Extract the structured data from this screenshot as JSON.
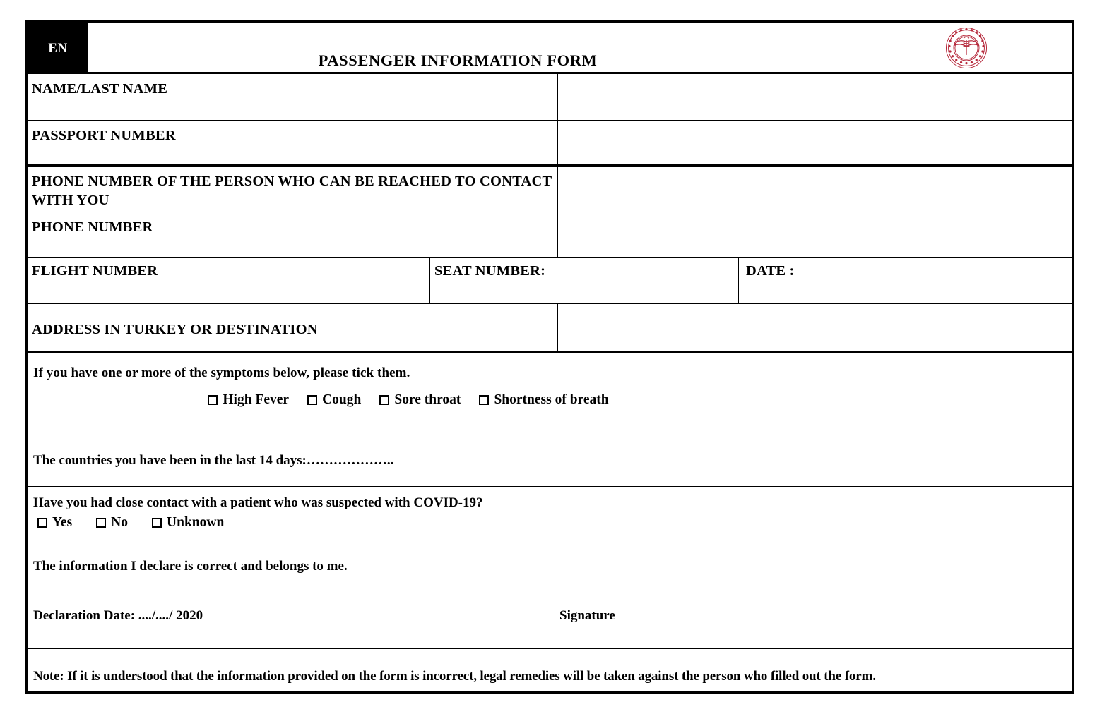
{
  "header": {
    "language_badge": "EN",
    "title": "PASSENGER INFORMATION FORM",
    "logo_name": "ministry-of-health-emblem",
    "logo_color": "#b5273a"
  },
  "fields": [
    {
      "label": "NAME/LAST NAME",
      "value": ""
    },
    {
      "label": "PASSPORT NUMBER",
      "value": ""
    },
    {
      "label": "PHONE NUMBER OF  THE PERSON WHO CAN BE REACHED TO CONTACT WITH YOU",
      "value": ""
    },
    {
      "label": "PHONE NUMBER",
      "value": ""
    }
  ],
  "flight_row": {
    "flight_label": "FLIGHT NUMBER",
    "flight_value": "",
    "seat_label": "SEAT NUMBER:",
    "seat_value": "",
    "date_label": "DATE :",
    "date_value": ""
  },
  "address": {
    "label": "ADDRESS IN TURKEY OR DESTINATION",
    "value": ""
  },
  "symptoms": {
    "prompt": "If you have one or more of the symptoms below, please tick them.",
    "options": [
      {
        "label": "High Fever",
        "checked": false
      },
      {
        "label": "Cough",
        "checked": false
      },
      {
        "label": "Sore throat",
        "checked": false
      },
      {
        "label": "Shortness of breath",
        "checked": false
      }
    ]
  },
  "countries": {
    "text": "The countries you have been in the last 14 days:………………..",
    "value": ""
  },
  "close_contact": {
    "question": "Have you had close contact with a patient who was suspected with COVID-19?",
    "options": [
      {
        "label": "Yes",
        "checked": false
      },
      {
        "label": "No",
        "checked": false
      },
      {
        "label": "Unknown",
        "checked": false
      }
    ]
  },
  "declaration": {
    "statement": "The information I declare is correct and belongs to me.",
    "date_label": "Declaration Date: ..../..../ 2020",
    "signature_label": "Signature"
  },
  "note": {
    "text": "Note: If it is understood that the information provided on the form is incorrect, legal remedies will be taken against the person who filled out the form."
  }
}
